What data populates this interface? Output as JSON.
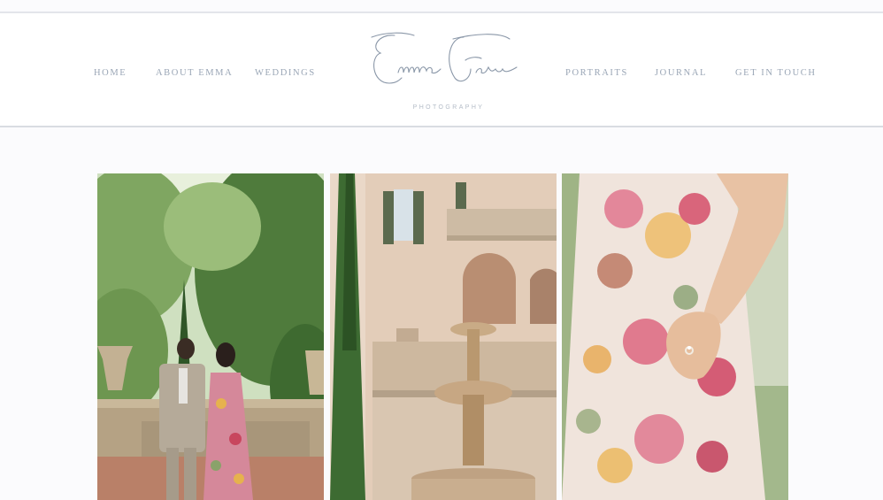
{
  "nav": {
    "left": [
      "HOME",
      "ABOUT EMMA",
      "WEDDINGS"
    ],
    "right": [
      "PORTRAITS",
      "JOURNAL",
      "GET IN TOUCH"
    ]
  },
  "logo": {
    "script": "Emma Farr",
    "subtitle": "PHOTOGRAPHY"
  },
  "gallery": {
    "photos": [
      "engagement-couple-terrace",
      "villa-fountain",
      "floral-dress-ring"
    ]
  },
  "colors": {
    "nav_text": "#9aa6b6",
    "logo_ink": "#8a97a8",
    "background": "#fbfbfd"
  }
}
